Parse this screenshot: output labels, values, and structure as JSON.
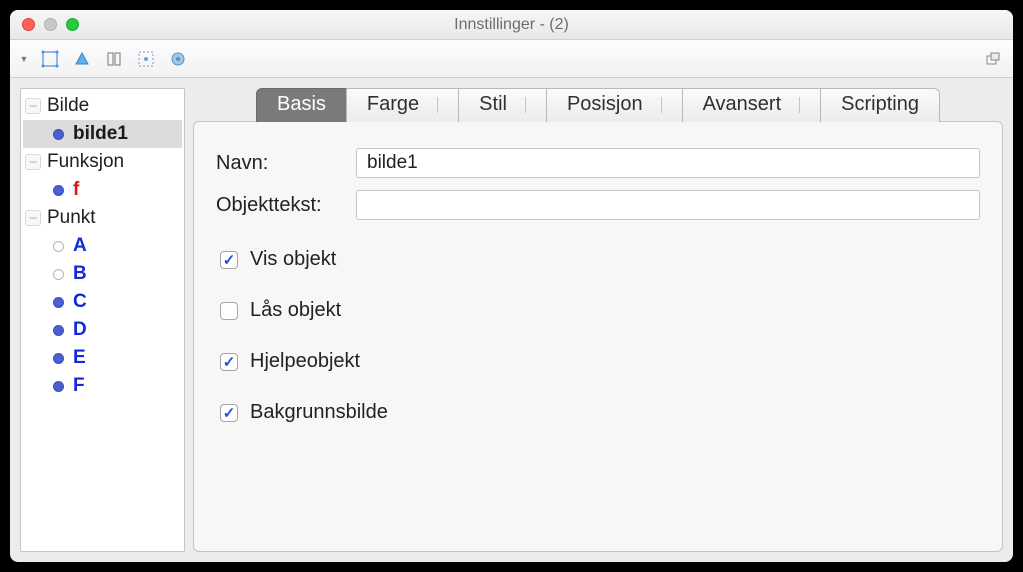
{
  "window": {
    "title": "Innstillinger - (2)"
  },
  "toolbar": {
    "icons": [
      "dropdown",
      "move",
      "point-style",
      "construct",
      "navigation",
      "properties"
    ],
    "detach_icon": "detach"
  },
  "sidebar": {
    "groups": [
      {
        "label": "Bilde",
        "items": [
          {
            "label": "bilde1",
            "color": "black",
            "dot": "filled",
            "selected": true
          }
        ]
      },
      {
        "label": "Funksjon",
        "items": [
          {
            "label": "f",
            "color": "red",
            "dot": "filled",
            "selected": false
          }
        ]
      },
      {
        "label": "Punkt",
        "items": [
          {
            "label": "A",
            "color": "blue",
            "dot": "empty",
            "selected": false
          },
          {
            "label": "B",
            "color": "blue",
            "dot": "empty",
            "selected": false
          },
          {
            "label": "C",
            "color": "blue",
            "dot": "filled",
            "selected": false
          },
          {
            "label": "D",
            "color": "blue",
            "dot": "filled",
            "selected": false
          },
          {
            "label": "E",
            "color": "blue",
            "dot": "filled",
            "selected": false
          },
          {
            "label": "F",
            "color": "blue",
            "dot": "filled",
            "selected": false
          }
        ]
      }
    ]
  },
  "tabs": {
    "items": [
      {
        "label": "Basis",
        "active": true
      },
      {
        "label": "Farge",
        "active": false
      },
      {
        "label": "Stil",
        "active": false
      },
      {
        "label": "Posisjon",
        "active": false
      },
      {
        "label": "Avansert",
        "active": false
      },
      {
        "label": "Scripting",
        "active": false
      }
    ]
  },
  "panel": {
    "name_label": "Navn:",
    "name_value": "bilde1",
    "caption_label": "Objekttekst:",
    "caption_value": "",
    "checkboxes": [
      {
        "label": "Vis objekt",
        "checked": true
      },
      {
        "label": "Lås objekt",
        "checked": false
      },
      {
        "label": "Hjelpeobjekt",
        "checked": true
      },
      {
        "label": "Bakgrunnsbilde",
        "checked": true
      }
    ]
  }
}
